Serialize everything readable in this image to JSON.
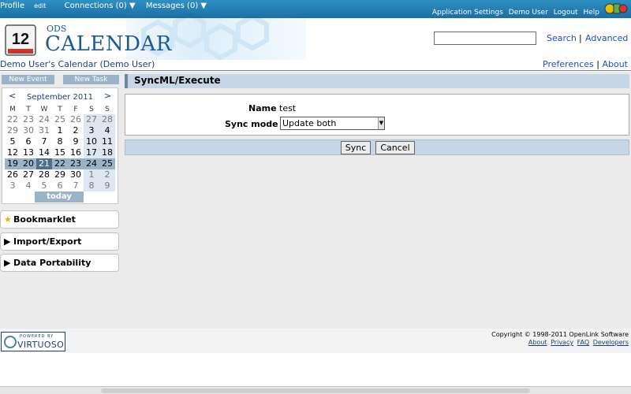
{
  "topbar": {
    "profile": "Profile",
    "profile_edit": "edit",
    "connections": "Connections (0) ▼",
    "messages": "Messages (0) ▼",
    "right_links": [
      "Application Settings",
      "Demo User",
      "Logout",
      "Help"
    ]
  },
  "header": {
    "logo_day": "12",
    "logo_ods": "ODS",
    "logo_calendar": "CALENDAR",
    "search_value": "",
    "search_link": "Search",
    "separator": "|",
    "advanced_link": "Advanced"
  },
  "subheader": {
    "calendar_owner_prefix": "Demo User's Calendar (",
    "calendar_owner_user": "Demo User",
    "calendar_owner_suffix": ")",
    "preferences": "Preferences",
    "separator": "|",
    "about": "About"
  },
  "sidebar": {
    "new_event": "New Event",
    "new_task": "New Task",
    "calendar": {
      "prev": "<",
      "next": ">",
      "month": "September 2011",
      "days_of_week": [
        "M",
        "T",
        "W",
        "T",
        "F",
        "S",
        "S"
      ],
      "weeks": [
        [
          "22",
          "23",
          "24",
          "25",
          "26",
          "27",
          "28"
        ],
        [
          "29",
          "30",
          "31",
          "1",
          "2",
          "3",
          "4"
        ],
        [
          "5",
          "6",
          "7",
          "8",
          "9",
          "10",
          "11"
        ],
        [
          "12",
          "13",
          "14",
          "15",
          "16",
          "17",
          "18"
        ],
        [
          "19",
          "20",
          "21",
          "22",
          "23",
          "24",
          "25"
        ],
        [
          "26",
          "27",
          "28",
          "29",
          "30",
          "1",
          "2"
        ],
        [
          "3",
          "4",
          "5",
          "6",
          "7",
          "8",
          "9"
        ]
      ],
      "today_button": "today",
      "selected_day": "21"
    },
    "panels": [
      "Bookmarklet",
      "Import/Export",
      "Data Portability"
    ]
  },
  "content": {
    "title": "SyncML/Execute",
    "name_label": "Name",
    "name_value": "test",
    "sync_mode_label": "Sync mode",
    "sync_mode_value": "Update both",
    "sync_button": "Sync",
    "cancel_button": "Cancel"
  },
  "footer": {
    "powered_by": "POWERED BY",
    "virtuoso": "VIRTUOSO",
    "copyright": "Copyright © 1998-2011 OpenLink Software",
    "links": [
      "About",
      "Privacy",
      "FAQ",
      "Developers"
    ]
  },
  "colors": {
    "topbar": "#1a6fa3",
    "accent": "#1c5a94",
    "bar": "#c6d6e6",
    "highlight": "#9bb3c8"
  }
}
